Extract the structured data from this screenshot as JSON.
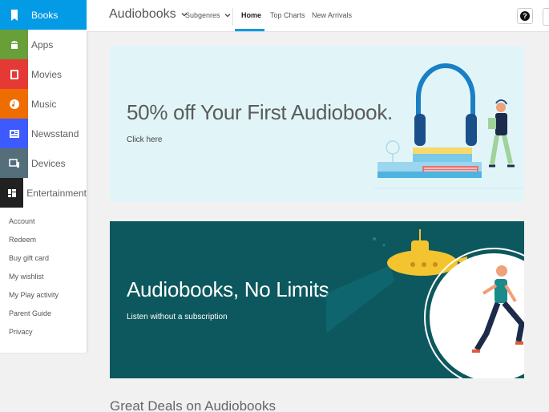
{
  "sidebar": {
    "categories": [
      {
        "label": "Books",
        "icon": "bookmark-icon",
        "color": "#039be5",
        "active": true
      },
      {
        "label": "Apps",
        "icon": "android-icon",
        "color": "#689f38"
      },
      {
        "label": "Movies",
        "icon": "film-icon",
        "color": "#e53935"
      },
      {
        "label": "Music",
        "icon": "music-note-icon",
        "color": "#ef6c00"
      },
      {
        "label": "Newsstand",
        "icon": "newspaper-icon",
        "color": "#3d5afe"
      },
      {
        "label": "Devices",
        "icon": "devices-icon",
        "color": "#546e7a"
      },
      {
        "label": "Entertainment",
        "icon": "dashboard-icon",
        "color": "#212121"
      }
    ],
    "links": [
      "Account",
      "Redeem",
      "Buy gift card",
      "My wishlist",
      "My Play activity",
      "Parent Guide",
      "Privacy"
    ]
  },
  "topbar": {
    "title": "Audiobooks",
    "subgenres": "Subgenres",
    "tabs": [
      "Home",
      "Top Charts",
      "New Arrivals"
    ],
    "help_icon": "help-icon"
  },
  "banners": [
    {
      "headline": "50% off Your First Audiobook.",
      "cta": "Click here",
      "bg": "#e1f5f8"
    },
    {
      "headline": "Audiobooks, No Limits",
      "cta": "Listen without a subscription",
      "bg": "#0c585e"
    }
  ],
  "section_title": "Great Deals on Audiobooks"
}
